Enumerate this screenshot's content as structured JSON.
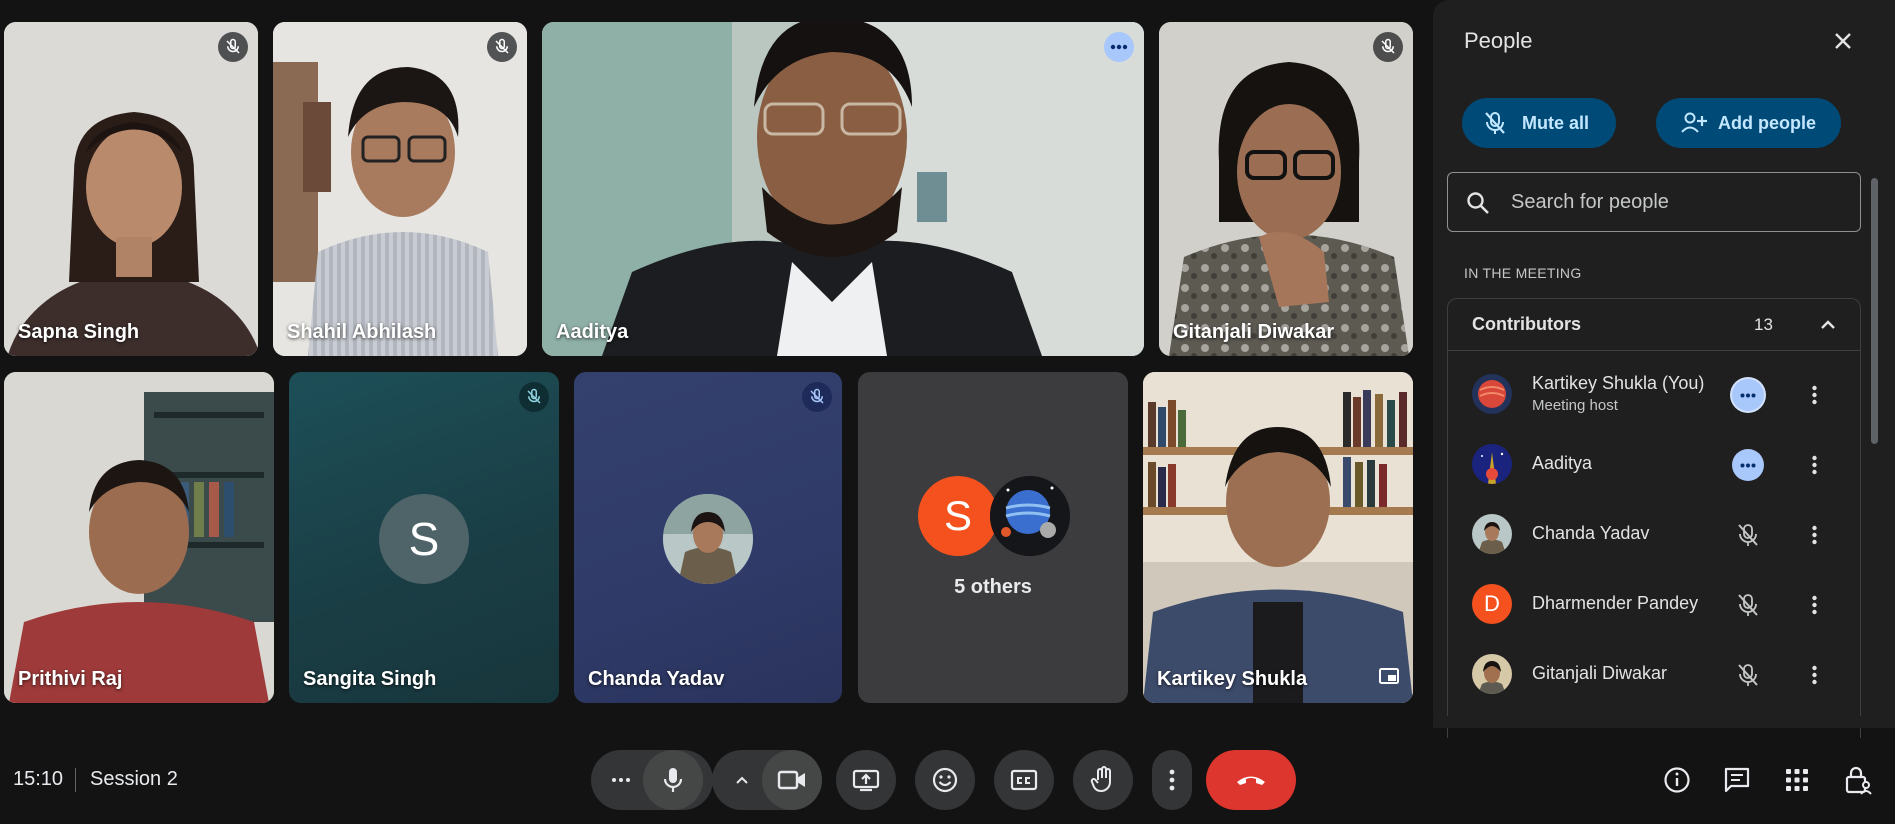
{
  "tiles": [
    {
      "name": "Sapna Singh",
      "muted": true
    },
    {
      "name": "Shahil Abhilash",
      "muted": true
    },
    {
      "name": "Aaditya",
      "speaking": true
    },
    {
      "name": "Gitanjali Diwakar",
      "muted": true
    },
    {
      "name": "Prithivi Raj"
    },
    {
      "name": "Sangita Singh",
      "muted": true,
      "avatar_letter": "S"
    },
    {
      "name": "Chanda Yadav",
      "muted": true
    },
    {
      "name": "5 others",
      "avatar_letter": "S"
    },
    {
      "name": "Kartikey Shukla"
    }
  ],
  "bottom_bar": {
    "time": "15:10",
    "meeting_name": "Session 2"
  },
  "people_panel": {
    "title": "People",
    "mute_all_label": "Mute all",
    "add_people_label": "Add people",
    "search_placeholder": "Search for people",
    "section_label": "IN THE MEETING",
    "contributors_label": "Contributors",
    "contributors_count": "13",
    "participants": [
      {
        "name": "Kartikey Shukla (You)",
        "role": "Meeting host",
        "status": "active"
      },
      {
        "name": "Aaditya",
        "status": "active"
      },
      {
        "name": "Chanda Yadav",
        "status": "muted"
      },
      {
        "name": "Dharmender Pandey",
        "status": "muted",
        "avatar_letter": "D"
      },
      {
        "name": "Gitanjali Diwakar",
        "status": "muted"
      }
    ]
  },
  "colors": {
    "accent_blue": "#a8c7fa",
    "end_call_red": "#dc362e",
    "pill_bg": "#004a77",
    "orange_avatar": "#f4511e"
  }
}
